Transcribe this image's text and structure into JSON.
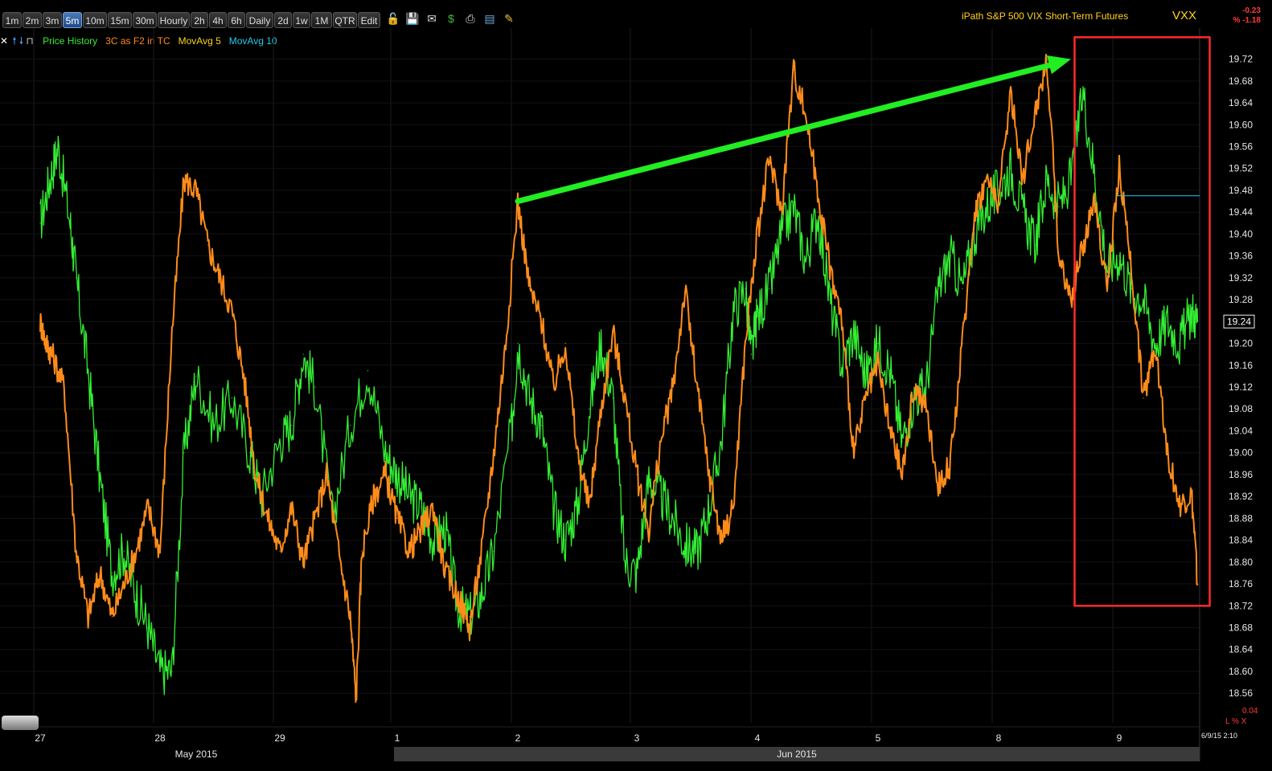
{
  "toolbar": {
    "timeframes": [
      {
        "label": "1m",
        "name": "tf-1m"
      },
      {
        "label": "2m",
        "name": "tf-2m"
      },
      {
        "label": "3m",
        "name": "tf-3m"
      },
      {
        "label": "5m",
        "name": "tf-5m",
        "active": true
      },
      {
        "label": "10m",
        "name": "tf-10m"
      },
      {
        "label": "15m",
        "name": "tf-15m"
      },
      {
        "label": "30m",
        "name": "tf-30m"
      },
      {
        "label": "Hourly",
        "name": "tf-hourly"
      },
      {
        "label": "2h",
        "name": "tf-2h"
      },
      {
        "label": "4h",
        "name": "tf-4h"
      },
      {
        "label": "6h",
        "name": "tf-6h"
      },
      {
        "label": "Daily",
        "name": "tf-daily"
      },
      {
        "label": "2d",
        "name": "tf-2d"
      },
      {
        "label": "1w",
        "name": "tf-1w"
      },
      {
        "label": "1M",
        "name": "tf-1m-month"
      },
      {
        "label": "QTR",
        "name": "tf-qtr"
      },
      {
        "label": "Edit",
        "name": "tf-edit"
      }
    ],
    "icons": [
      {
        "name": "lock-icon",
        "glyph": "🔓",
        "color": "#e8b23a"
      },
      {
        "name": "save-icon",
        "glyph": "💾",
        "color": "#4a86e8"
      },
      {
        "name": "mail-icon",
        "glyph": "✉",
        "color": "#dddddd"
      },
      {
        "name": "dollar-icon",
        "glyph": "$",
        "color": "#3bbf3b"
      },
      {
        "name": "print-icon",
        "glyph": "⎙",
        "color": "#dddddd"
      },
      {
        "name": "table-icon",
        "glyph": "▤",
        "color": "#6fa8dc"
      },
      {
        "name": "pencil-icon",
        "glyph": "✎",
        "color": "#f1c232"
      }
    ]
  },
  "header": {
    "title": "iPath S&P 500 VIX Short-Term Futures",
    "symbol": "VXX",
    "change_abs": "-0.23",
    "change_pct": "% -1.18"
  },
  "legend": {
    "items": [
      {
        "label": "Price History",
        "color": "#33ee33",
        "name": "legend-price-history"
      },
      {
        "label": "3C as F2 in TC",
        "color": "#ff8c1a",
        "name": "legend-3c"
      },
      {
        "label": "MovAvg 5",
        "color": "#ffd21a",
        "name": "legend-movavg-5"
      },
      {
        "label": "MovAvg 10",
        "color": "#22ccee",
        "name": "legend-movavg-10"
      }
    ]
  },
  "chart_data": {
    "type": "line",
    "x_labels": [
      "27",
      "28",
      "29",
      "1",
      "2",
      "3",
      "4",
      "5",
      "8",
      "9"
    ],
    "months": [
      "May 2015",
      "Jun 2015"
    ],
    "y_ticks": [
      19.72,
      19.68,
      19.64,
      19.6,
      19.56,
      19.52,
      19.48,
      19.44,
      19.4,
      19.36,
      19.32,
      19.28,
      19.24,
      19.2,
      19.16,
      19.12,
      19.08,
      19.04,
      19.0,
      18.96,
      18.92,
      18.88,
      18.84,
      18.8,
      18.76,
      18.72,
      18.68,
      18.64,
      18.6,
      18.56
    ],
    "ylim": [
      18.55,
      19.74
    ],
    "last_price": "19.24",
    "grid": true,
    "series": [
      {
        "name": "Price History",
        "color": "#33ee33",
        "x": [
          0,
          0.08,
          0.15,
          0.25,
          0.3,
          0.4,
          0.5,
          0.6,
          0.7,
          0.8,
          0.9,
          1.0,
          1.1,
          1.2,
          1.3,
          1.45,
          1.6,
          1.75,
          1.85,
          2.0,
          2.1,
          2.2,
          2.3,
          2.45,
          2.6,
          2.75,
          2.9,
          3.0,
          3.1,
          3.2,
          3.3,
          3.4,
          3.5,
          3.6,
          3.7,
          3.8,
          3.95,
          4.0,
          4.1,
          4.2,
          4.3,
          4.4,
          4.5,
          4.6,
          4.7,
          4.8,
          4.9,
          5.0,
          5.1,
          5.2,
          5.3,
          5.4,
          5.5,
          5.6,
          5.7,
          5.8,
          5.9,
          5.95,
          6.0,
          6.1,
          6.2,
          6.3,
          6.4,
          6.5,
          6.6,
          6.7,
          6.8,
          6.9,
          7.0,
          7.1,
          7.2,
          7.3,
          7.4,
          7.5,
          7.6,
          7.7,
          7.8,
          7.9,
          8.0,
          8.1,
          8.2,
          8.3,
          8.4,
          8.5,
          8.6,
          8.7,
          8.8,
          8.9,
          9.0,
          9.1,
          9.2,
          9.3,
          9.4,
          9.5,
          9.6,
          9.65
        ],
        "values": [
          19.42,
          19.5,
          19.56,
          19.42,
          19.32,
          19.15,
          18.95,
          18.78,
          18.82,
          18.74,
          18.68,
          18.6,
          18.6,
          19.0,
          19.14,
          19.05,
          19.1,
          19.0,
          18.92,
          19.02,
          19.05,
          19.18,
          19.12,
          18.88,
          19.05,
          19.15,
          19.0,
          18.96,
          18.92,
          18.9,
          18.84,
          18.86,
          18.72,
          18.7,
          18.74,
          18.82,
          19.05,
          19.2,
          19.1,
          19.05,
          18.9,
          18.84,
          18.9,
          19.08,
          19.2,
          19.1,
          18.8,
          18.78,
          18.95,
          18.92,
          18.88,
          18.83,
          18.82,
          18.9,
          19.02,
          19.26,
          19.3,
          19.18,
          19.25,
          19.3,
          19.4,
          19.45,
          19.35,
          19.44,
          19.28,
          19.16,
          19.22,
          19.14,
          19.2,
          19.15,
          19.02,
          19.1,
          19.12,
          19.3,
          19.36,
          19.3,
          19.4,
          19.45,
          19.48,
          19.52,
          19.44,
          19.38,
          19.5,
          19.45,
          19.5,
          19.66,
          19.5,
          19.34,
          19.36,
          19.3,
          19.28,
          19.2,
          19.24,
          19.2,
          19.26,
          19.24
        ]
      },
      {
        "name": "3C as F2 in TC",
        "color": "#ff8c1a",
        "x": [
          0,
          0.05,
          0.1,
          0.2,
          0.3,
          0.4,
          0.5,
          0.6,
          0.7,
          0.8,
          0.9,
          1.0,
          1.1,
          1.2,
          1.3,
          1.4,
          1.5,
          1.6,
          1.7,
          1.8,
          1.9,
          2.0,
          2.1,
          2.2,
          2.3,
          2.4,
          2.5,
          2.6,
          2.65,
          2.7,
          2.8,
          2.9,
          3.0,
          3.1,
          3.2,
          3.3,
          3.4,
          3.5,
          3.6,
          3.7,
          3.8,
          3.9,
          4.0,
          4.1,
          4.2,
          4.3,
          4.4,
          4.5,
          4.6,
          4.7,
          4.8,
          4.9,
          5.0,
          5.1,
          5.2,
          5.3,
          5.4,
          5.5,
          5.6,
          5.7,
          5.8,
          5.9,
          6.0,
          6.1,
          6.2,
          6.3,
          6.4,
          6.5,
          6.6,
          6.7,
          6.8,
          6.9,
          7.0,
          7.1,
          7.2,
          7.3,
          7.4,
          7.5,
          7.6,
          7.7,
          7.8,
          7.9,
          8.0,
          8.1,
          8.2,
          8.3,
          8.4,
          8.5,
          8.6,
          8.7,
          8.8,
          8.9,
          9.0,
          9.1,
          9.2,
          9.3,
          9.4,
          9.5,
          9.6,
          9.65
        ],
        "values": [
          19.24,
          19.2,
          19.18,
          19.12,
          18.82,
          18.7,
          18.78,
          18.7,
          18.76,
          18.82,
          18.9,
          18.82,
          19.22,
          19.5,
          19.48,
          19.38,
          19.32,
          19.26,
          19.14,
          18.96,
          18.88,
          18.82,
          18.9,
          18.8,
          18.88,
          18.96,
          18.82,
          18.7,
          18.55,
          18.82,
          18.92,
          18.96,
          18.88,
          18.82,
          18.86,
          18.9,
          18.78,
          18.74,
          18.68,
          18.82,
          19.0,
          19.2,
          19.46,
          19.3,
          19.24,
          19.12,
          19.2,
          19.0,
          18.9,
          19.08,
          19.22,
          19.1,
          18.96,
          18.86,
          19.02,
          19.12,
          19.3,
          19.12,
          18.96,
          18.84,
          18.9,
          19.2,
          19.4,
          19.54,
          19.44,
          19.7,
          19.62,
          19.48,
          19.34,
          19.24,
          19.0,
          19.1,
          19.16,
          19.04,
          18.96,
          19.12,
          19.08,
          18.94,
          18.98,
          19.2,
          19.44,
          19.5,
          19.46,
          19.66,
          19.5,
          19.62,
          19.72,
          19.36,
          19.28,
          19.38,
          19.46,
          19.3,
          19.52,
          19.34,
          19.1,
          19.2,
          19.0,
          18.9,
          18.92,
          18.76
        ]
      }
    ],
    "annotations": [
      {
        "type": "arrow",
        "color": "#22ee22",
        "from": {
          "x": 4.0,
          "y": 19.46
        },
        "to": {
          "x": 8.6,
          "y": 19.72
        }
      },
      {
        "type": "box",
        "color": "#ff2a2a",
        "x0": 8.63,
        "x1": 9.75,
        "y0": 18.72,
        "y1": 19.76
      }
    ]
  },
  "footer": {
    "date_stamp": "6/9/15 2:10",
    "lower_value": "0.04",
    "lower_tag": "L % X"
  },
  "colors": {
    "background": "#000000",
    "grid": "#1c1c1c",
    "axis_text": "#e6e6e6"
  }
}
